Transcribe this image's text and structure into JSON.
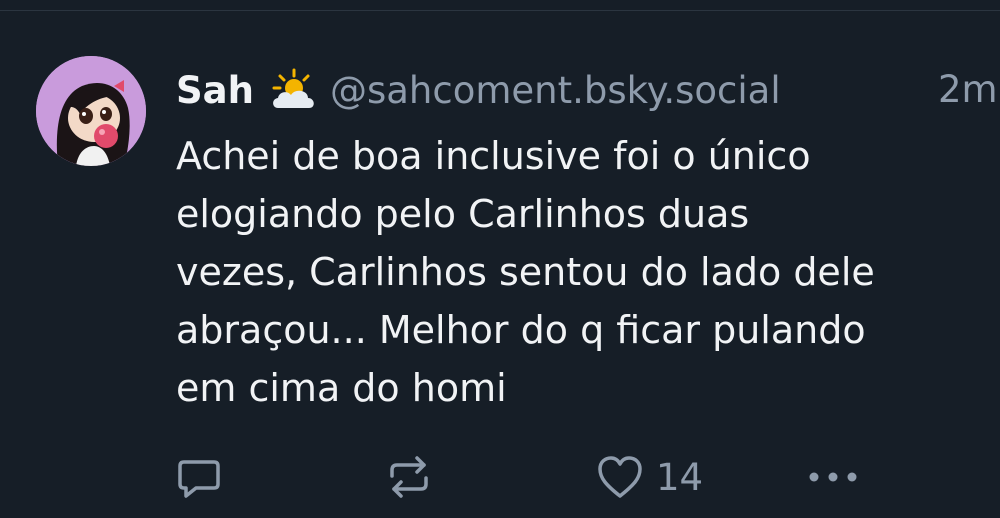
{
  "post": {
    "author": {
      "display_name": "Sah",
      "handle": "@sahcoment.bsky.social",
      "status_icon": "sun-behind-cloud-icon",
      "avatar_icon": "cartoon-girl-bubblegum-avatar"
    },
    "timestamp": "2m",
    "text": "Achei de boa inclusive foi o único\nelogiando pelo Carlinhos duas\nvezes, Carlinhos sentou do lado dele\nabraçou... Melhor do q ficar pulando\nem cima do homi",
    "actions": {
      "reply_icon": "reply-bubble-icon",
      "repost_icon": "repost-arrows-icon",
      "like_icon": "heart-icon",
      "like_count": "14",
      "more_icon": "more-dots-icon"
    }
  },
  "colors": {
    "background": "#161e27",
    "primary_text": "#f1f3f5",
    "secondary_text": "#8e9bab",
    "avatar_bg": "#c99bdc"
  }
}
